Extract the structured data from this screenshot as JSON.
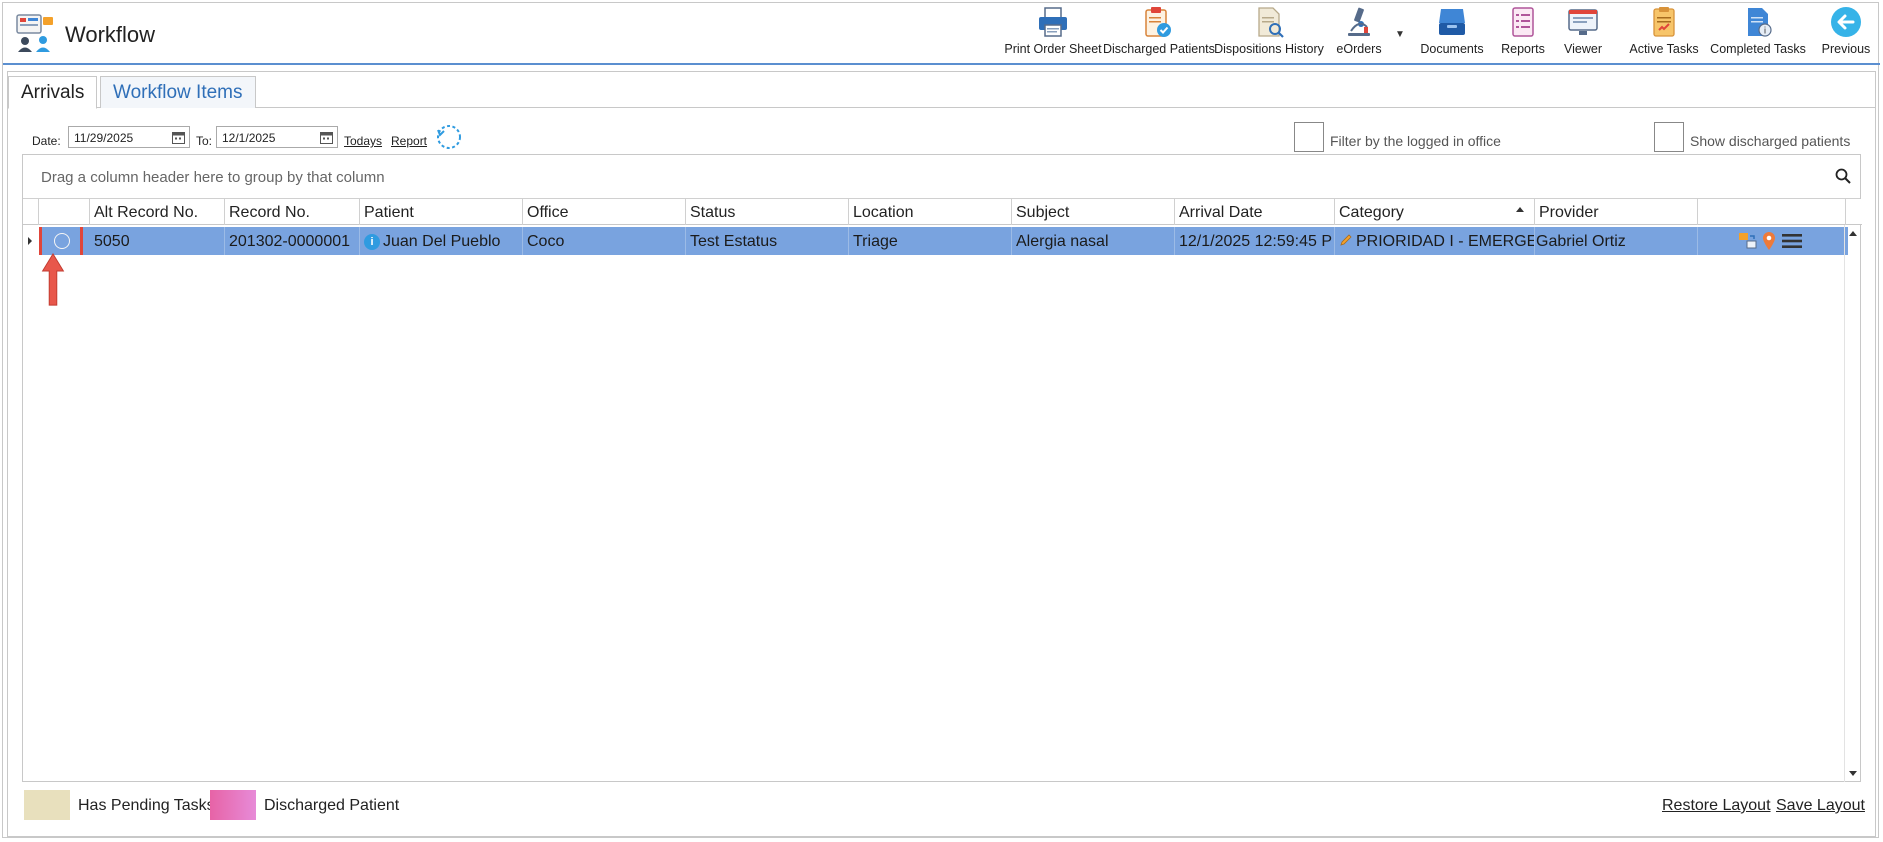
{
  "window": {
    "title": "Workflow"
  },
  "toolbar": {
    "buttons": [
      {
        "label": "Print Order Sheet",
        "icon": "printer-icon"
      },
      {
        "label": "Discharged Patients",
        "icon": "clipboard-check-icon"
      },
      {
        "label": "Dispositions History",
        "icon": "document-search-icon"
      },
      {
        "label": "eOrders",
        "icon": "microscope-icon"
      },
      {
        "label": "Documents",
        "icon": "inbox-tray-icon"
      },
      {
        "label": "Reports",
        "icon": "report-list-icon"
      },
      {
        "label": "Viewer",
        "icon": "monitor-viewer-icon"
      },
      {
        "label": "Active Tasks",
        "icon": "active-tasks-icon"
      },
      {
        "label": "Completed Tasks",
        "icon": "completed-tasks-icon"
      },
      {
        "label": "Previous",
        "icon": "back-arrow-icon"
      }
    ]
  },
  "tabs": [
    {
      "label": "Arrivals",
      "active": true
    },
    {
      "label": "Workflow Items",
      "active": false
    }
  ],
  "filters": {
    "date_label": "Date:",
    "date_from": "11/29/2025",
    "to_label": "To:",
    "date_to": "12/1/2025",
    "todays_link": "Todays",
    "report_link": "Report",
    "filter_office_label": "Filter by the logged in office",
    "show_discharged_label": "Show discharged patients"
  },
  "grid": {
    "group_hint": "Drag a column header here to group by that column",
    "columns": [
      "",
      "Alt Record No.",
      "Record No.",
      "Patient",
      "Office",
      "Status",
      "Location",
      "Subject",
      "Arrival Date",
      "Category",
      "Provider",
      ""
    ],
    "sorted_column": "Category",
    "rows": [
      {
        "alt_record_no": "5050",
        "record_no": "201302-0000001",
        "patient": "Juan Del Pueblo",
        "office": "Coco",
        "status": "Test Estatus",
        "location": "Triage",
        "subject": "Alergia nasal",
        "arrival_date": "12/1/2025 12:59:45 P",
        "category": "PRIORIDAD I - EMERGEN",
        "provider": "Gabriel Ortiz"
      }
    ]
  },
  "legend": [
    {
      "label": "Has Pending Tasks",
      "color": "#e8e0bd"
    },
    {
      "label": "Discharged Patient",
      "color": "#e763a6"
    }
  ],
  "footer": {
    "restore_layout": "Restore Layout",
    "save_layout": "Save Layout"
  },
  "colors": {
    "selected_row": "#79a3df",
    "highlight_box": "#e0453a",
    "accent_blue": "#2f6fb8"
  }
}
